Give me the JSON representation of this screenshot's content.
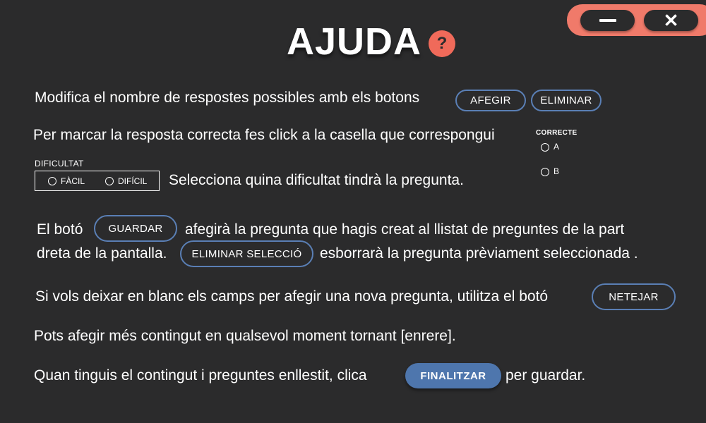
{
  "window": {
    "minimize_label": "—",
    "close_label": "✕"
  },
  "header": {
    "title": "AJUDA",
    "help_icon_label": "?"
  },
  "help": {
    "line1_text": "Modifica el nombre de respostes possibles amb els botons",
    "add_button": "AFEGIR",
    "remove_button": "ELIMINAR",
    "line2_text": "Per marcar la resposta correcta fes click a la casella que correspongui",
    "correct_label": "CORRECTE",
    "option_a": "A",
    "option_b": "B",
    "difficulty_label": "DIFICULTAT",
    "easy_label": "FÀCIL",
    "hard_label": "DIFÍCIL",
    "line3_text": "Selecciona quina dificultat tindrà la pregunta.",
    "line4_prefix": "El botó",
    "save_button": "GUARDAR",
    "line4_suffix": "afegirà la pregunta que hagis creat al llistat de preguntes de la part",
    "line5_prefix": "dreta de la pantalla.",
    "remove_selection_button": "ELIMINAR SELECCIÓ",
    "line5_suffix": "esborrarà la pregunta prèviament seleccionada .",
    "line6_text": "Si vols deixar en blanc els camps per afegir una nova pregunta, utilitza el botó",
    "clear_button": "NETEJAR",
    "line7_text": "Pots afegir més contingut en qualsevol moment tornant [enrere].",
    "line8_prefix": "Quan tinguis el contingut i preguntes enllestit, clica",
    "finish_button": "FINALITZAR",
    "line8_suffix": "per guardar."
  },
  "colors": {
    "background": "#2b2b2c",
    "accent": "#f07a6a",
    "button_border": "#5a7fb5",
    "button_fill": "#4e76ad"
  }
}
